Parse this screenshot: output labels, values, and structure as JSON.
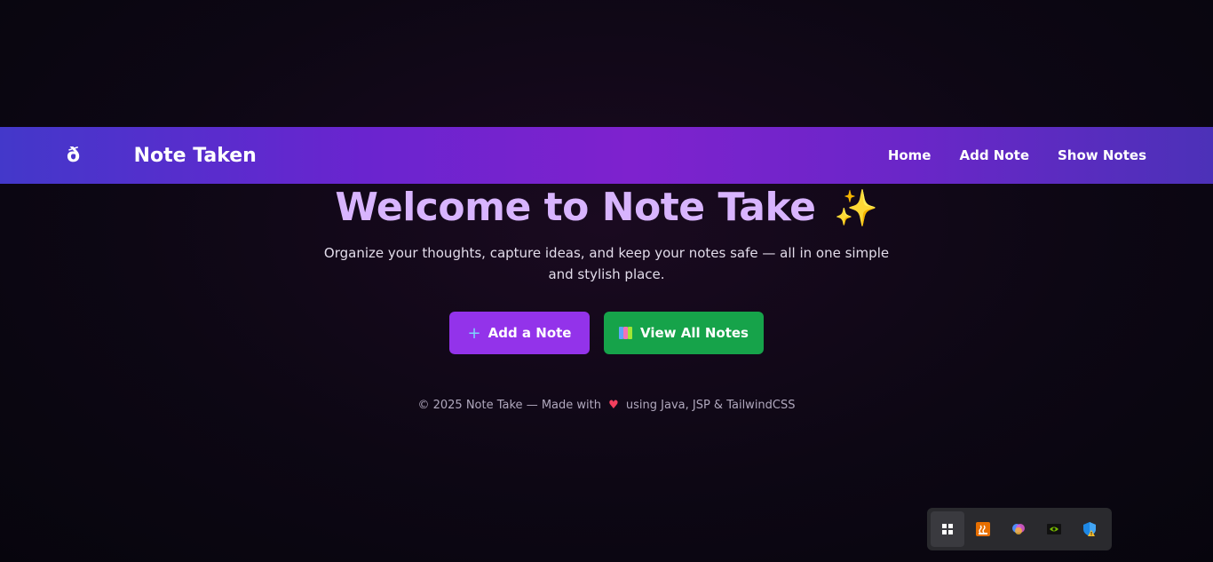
{
  "navbar": {
    "brand": "ð Note Taken",
    "links": [
      {
        "label": "Home"
      },
      {
        "label": "Add Note"
      },
      {
        "label": "Show Notes"
      }
    ]
  },
  "hero": {
    "title": "Welcome to Note Take",
    "title_emoji": "✨",
    "subtitle": "Organize your thoughts, capture ideas, and keep your notes safe — all in one simple and stylish place."
  },
  "actions": {
    "add_label": "Add a Note",
    "add_icon": "+",
    "view_label": "View All Notes"
  },
  "footer": {
    "prefix": "© 2025 Note Take — Made with",
    "heart": "♥",
    "suffix": "using Java, JSP & TailwindCSS"
  },
  "tray": {
    "items": [
      "windows-start-icon",
      "java-icon",
      "copilot-icon",
      "nvidia-icon",
      "defender-warning-icon"
    ]
  },
  "colors": {
    "hero_title": "#d8b4fe",
    "add_button": "#9333ea",
    "view_button": "#16a34a",
    "navbar_center": "#7e22ce"
  }
}
